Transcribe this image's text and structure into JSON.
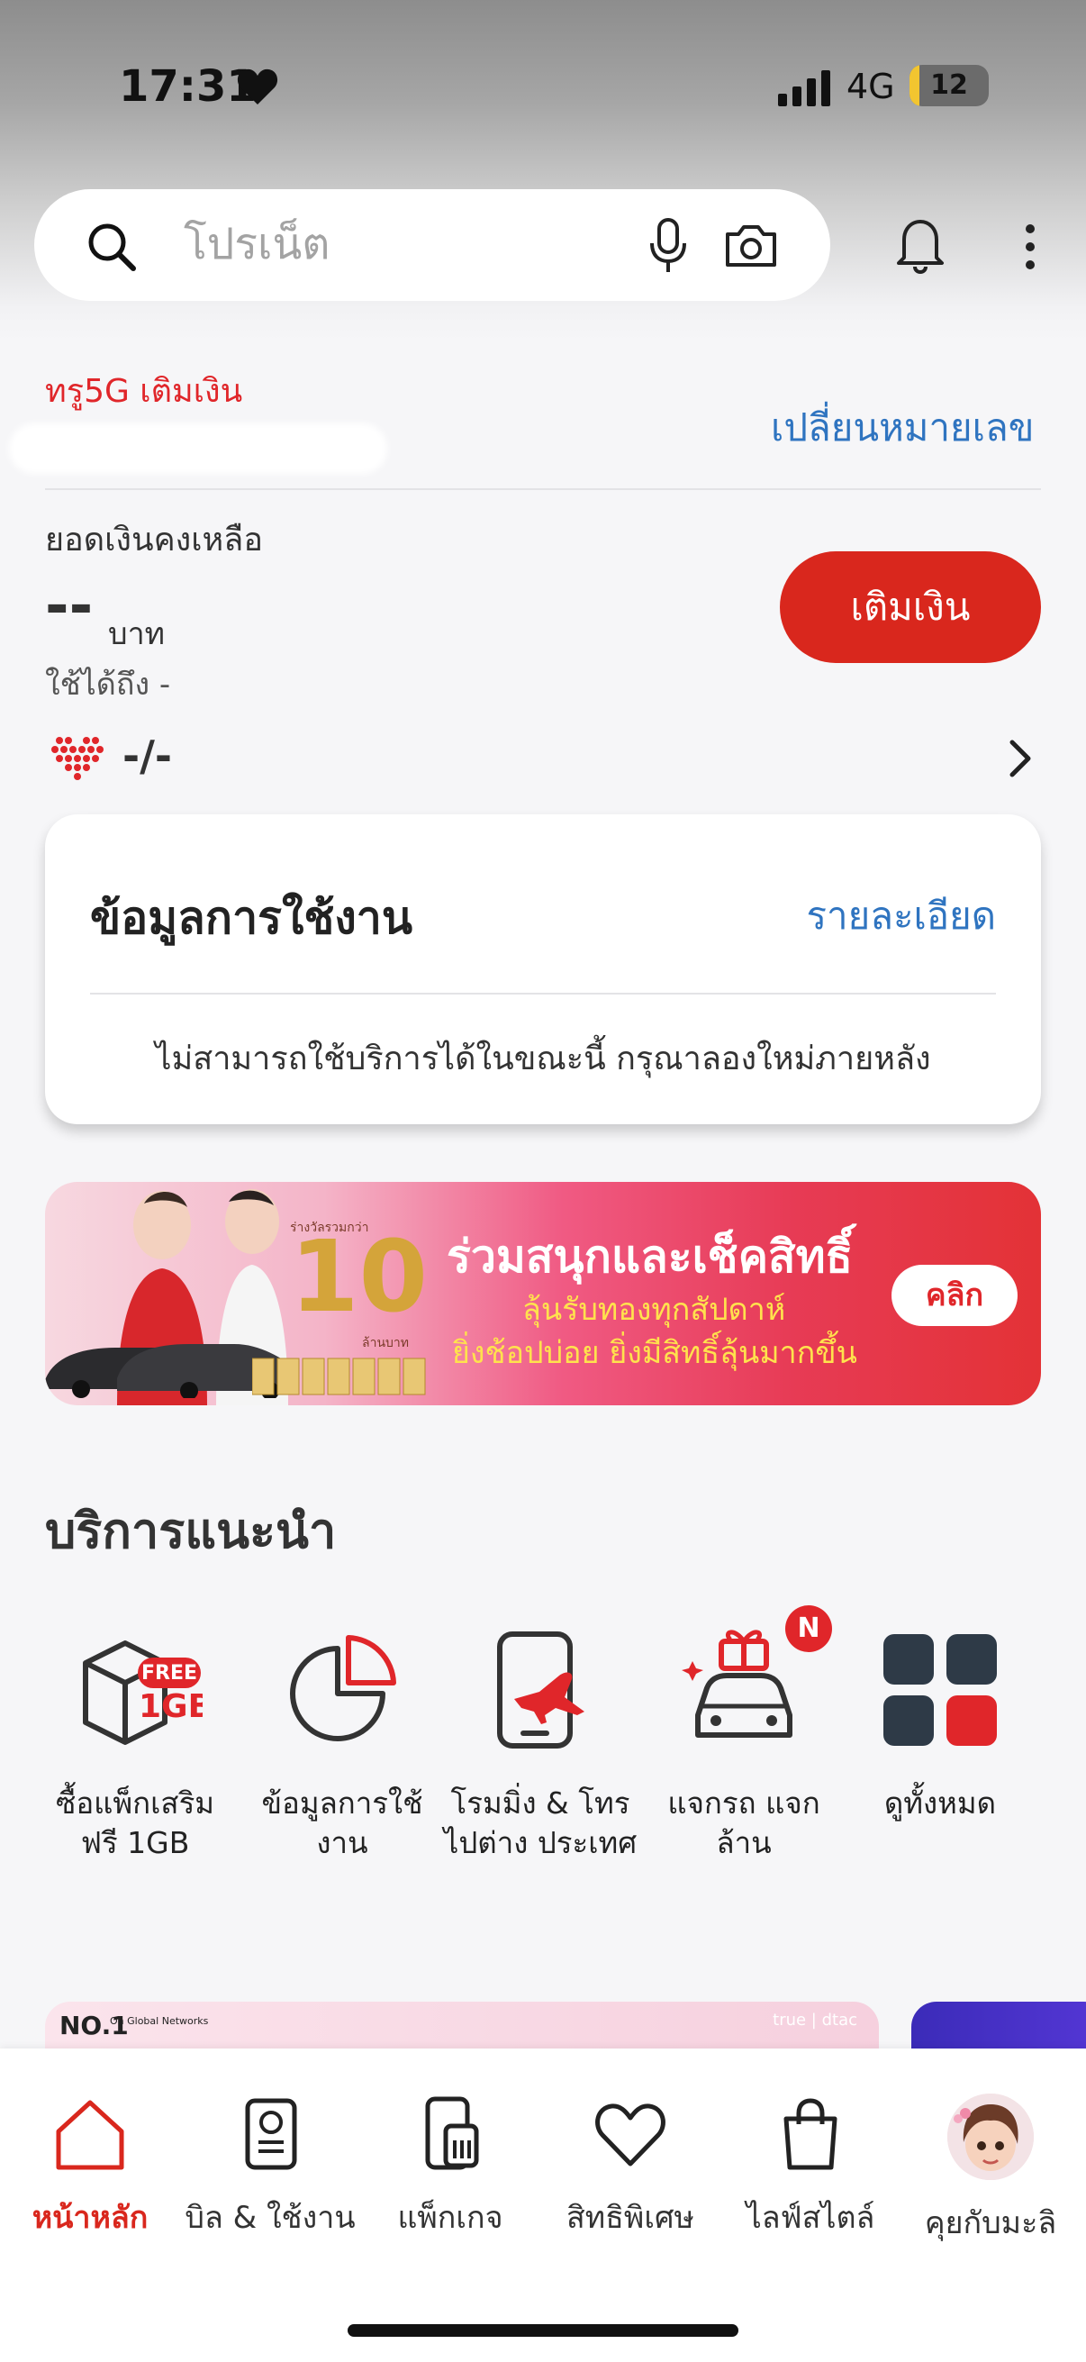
{
  "status_bar": {
    "time": "17:31",
    "network": "4G",
    "battery_level": "12",
    "battery_fraction": 0.12
  },
  "search": {
    "placeholder": "โปรเน็ต"
  },
  "account": {
    "label": "ทรู5G เติมเงิน",
    "change_number": "เปลี่ยนหมายเลข",
    "balance_label": "ยอดเงินคงเหลือ",
    "balance_value": "--",
    "balance_unit": "บาท",
    "valid_until": "ใช้ได้ถึง -",
    "topup_button": "เติมเงิน",
    "points_value": "-/-"
  },
  "usage_card": {
    "title": "ข้อมูลการใช้งาน",
    "details_link": "รายละเอียด",
    "message": "ไม่สามารถใช้บริการได้ในขณะนี้ กรุณาลองใหม่ภายหลัง"
  },
  "banner": {
    "small_top": "ร่างวัลรวมกว่า",
    "big_number": "10",
    "small_bottom": "ล้านบาท",
    "title": "ร่วมสนุกและเช็คสิทธิ์",
    "subtitle_1": "ลุ้นรับทองทุกสัปดาห์",
    "subtitle_2": "ยิ่งช้อปบ่อย ยิ่งมีสิทธิ์ลุ้นมากขึ้น",
    "click_label": "คลิก"
  },
  "services": {
    "title": "บริการแนะนำ",
    "items": [
      {
        "label": "ซื้อแพ็กเสริม ฟรี 1GB",
        "icon": "box-free-1gb-icon",
        "free_text": "FREE",
        "gb_text": "1GB"
      },
      {
        "label": "ข้อมูลการใช้ งาน",
        "icon": "pie-chart-icon"
      },
      {
        "label": "โรมมิ่ง & โทร ไปต่าง ประเทศ",
        "icon": "phone-plane-icon"
      },
      {
        "label": "แจกรถ แจก ล้าน",
        "icon": "car-gift-icon",
        "badge": "N"
      },
      {
        "label": "ดูทั้งหมด",
        "icon": "grid-icon"
      }
    ]
  },
  "promo": {
    "card1_no1": "NO.1",
    "card1_sub": "On Global Networks",
    "card1_brand": "true | dtac"
  },
  "bottom_nav": {
    "items": [
      {
        "label": "หน้าหลัก",
        "icon": "home-icon",
        "active": true
      },
      {
        "label": "บิล & ใช้งาน",
        "icon": "bill-icon"
      },
      {
        "label": "แพ็กเกจ",
        "icon": "package-icon"
      },
      {
        "label": "สิทธิพิเศษ",
        "icon": "heart-icon"
      },
      {
        "label": "ไลฟ์สไตล์",
        "icon": "shopping-bag-icon"
      },
      {
        "label": "คุยกับมะลิ",
        "icon": "avatar-mali"
      }
    ]
  },
  "colors": {
    "accent_red": "#d9271d",
    "link_blue": "#2f74c0",
    "battery_yellow": "#f2c530"
  }
}
